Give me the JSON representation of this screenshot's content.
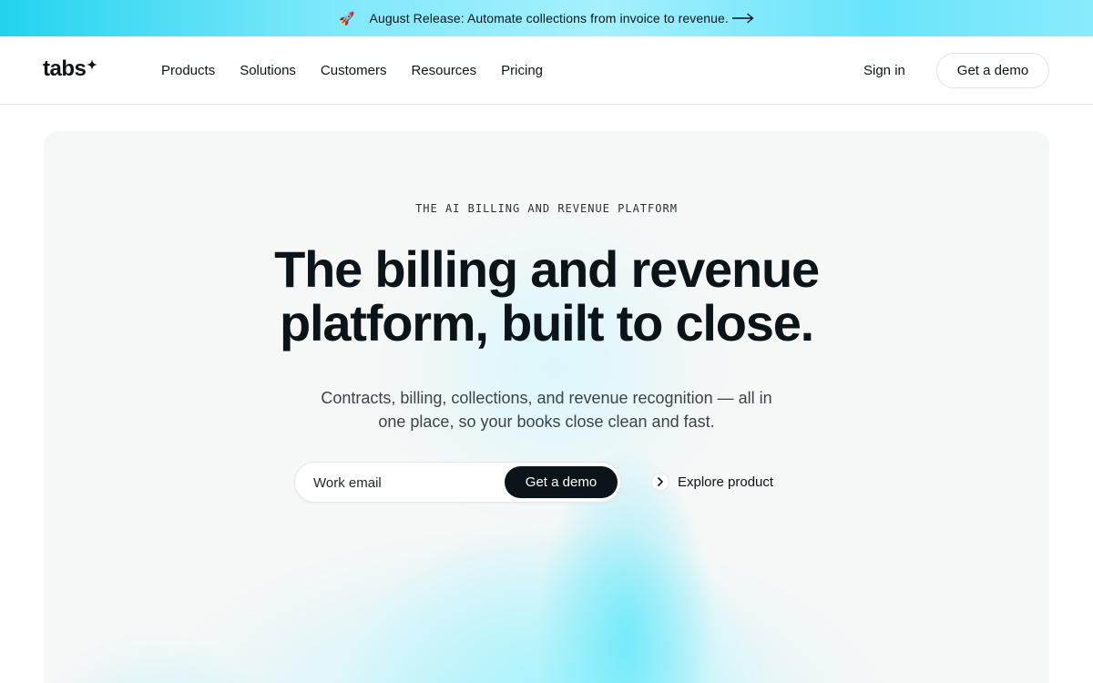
{
  "announcement": {
    "icon": "rocket-icon",
    "text": "August Release: Automate collections from invoice to revenue.",
    "arrow_icon": "long-arrow-right-icon"
  },
  "header": {
    "logo_text": "tabs",
    "logo_icon": "sparkle-icon",
    "nav": [
      "Products",
      "Solutions",
      "Customers",
      "Resources",
      "Pricing"
    ],
    "sign_in": "Sign in",
    "cta": "Get a demo"
  },
  "hero": {
    "eyebrow": "THE AI BILLING AND REVENUE PLATFORM",
    "headline_line1": "The billing and revenue",
    "headline_line2": "platform, built to close.",
    "subhead": "Contracts, billing, collections, and revenue recognition — all in one place, so your books close clean and fast.",
    "email_placeholder": "Work email",
    "email_value": "",
    "form_cta": "Get a demo",
    "explore_label": "Explore product",
    "explore_icon": "chevron-right-icon"
  },
  "colors": {
    "accent": "#22d3ee",
    "text": "#0b1418",
    "button_dark": "#0b1418"
  }
}
